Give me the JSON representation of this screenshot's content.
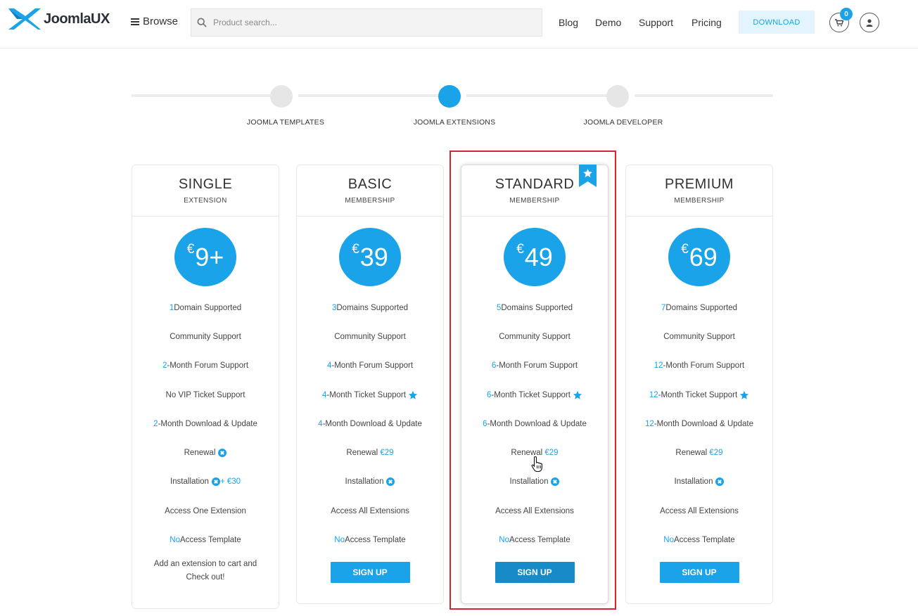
{
  "header": {
    "logo_text": "JoomlaUX",
    "browse_label": "Browse",
    "search_placeholder": "Product search...",
    "nav": [
      "Blog",
      "Demo",
      "Support",
      "Pricing"
    ],
    "download_label": "DOWNLOAD",
    "cart_count": "0",
    "accent_color": "#1aa3e8"
  },
  "stepper": {
    "steps": [
      {
        "label": "JOOMLA TEMPLATES",
        "active": false
      },
      {
        "label": "JOOMLA EXTENSIONS",
        "active": true
      },
      {
        "label": "JOOMLA DEVELOPER",
        "active": false
      }
    ]
  },
  "plans": [
    {
      "name": "SINGLE",
      "sub": "EXTENSION",
      "currency": "€",
      "price": "9+",
      "features": {
        "domains": {
          "num": "1",
          "text": " Domain Supported"
        },
        "community": "Community Support",
        "forum": {
          "num": "2",
          "text": " -Month Forum Support"
        },
        "ticket": {
          "prefix": "No VIP Ticket Support",
          "num": "",
          "text": ""
        },
        "download": {
          "num": "2",
          "text": "-Month Download & Update"
        },
        "renewal_label": "Renewal",
        "renewal_value": "",
        "installation_label": "Installation",
        "installation_extra": " + €30",
        "access": "Access One Extension",
        "template": {
          "num": "No",
          "text": " Access Template"
        }
      },
      "footer_note": "Add an extension to cart and Check out!"
    },
    {
      "name": "BASIC",
      "sub": "MEMBERSHIP",
      "currency": "€",
      "price": "39",
      "features": {
        "domains": {
          "num": "3",
          "text": " Domains Supported"
        },
        "community": "Community Support",
        "forum": {
          "num": "4",
          "text": "-Month Forum Support"
        },
        "ticket": {
          "num": "4",
          "text": "-Month Ticket Support"
        },
        "download": {
          "num": "4",
          "text": "-Month Download & Update"
        },
        "renewal_label": "Renewal",
        "renewal_value": "€29",
        "installation_label": "Installation",
        "access": "Access All Extensions",
        "template": {
          "num": "No",
          "text": " Access Template"
        }
      },
      "signup_label": "SIGN UP"
    },
    {
      "name": "STANDARD",
      "sub": "MEMBERSHIP",
      "currency": "€",
      "price": "49",
      "features": {
        "domains": {
          "num": "5",
          "text": " Domains Supported"
        },
        "community": "Community Support",
        "forum": {
          "num": "6",
          "text": "-Month Forum Support"
        },
        "ticket": {
          "num": "6",
          "text": "-Month Ticket Support"
        },
        "download": {
          "num": "6",
          "text": "-Month Download & Update"
        },
        "renewal_label": "Renewal",
        "renewal_value": "€29",
        "installation_label": "Installation",
        "access": "Access All Extensions",
        "template": {
          "num": "No",
          "text": " Access Template"
        }
      },
      "signup_label": "SIGN UP"
    },
    {
      "name": "PREMIUM",
      "sub": "MEMBERSHIP",
      "currency": "€",
      "price": "69",
      "features": {
        "domains": {
          "num": "7",
          "text": " Domains Supported"
        },
        "community": "Community Support",
        "forum": {
          "num": "12",
          "text": "-Month Forum Support"
        },
        "ticket": {
          "num": "12",
          "text": "-Month Ticket Support"
        },
        "download": {
          "num": "12",
          "text": "-Month Download & Update"
        },
        "renewal_label": "Renewal",
        "renewal_value": "€29",
        "installation_label": "Installation",
        "access": "Access All Extensions",
        "template": {
          "num": "No",
          "text": " Access Template"
        }
      },
      "signup_label": "SIGN UP"
    }
  ]
}
